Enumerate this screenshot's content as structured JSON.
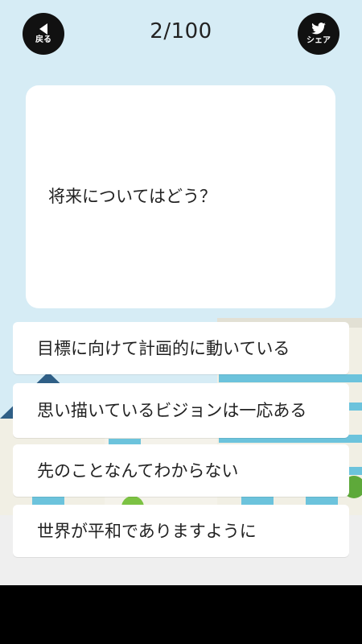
{
  "header": {
    "back_label": "戻る",
    "counter": "2/100",
    "share_label": "シェア"
  },
  "question": {
    "text": "将来についてはどう？"
  },
  "answers": [
    {
      "label": "目標に向けて計画的に動いている"
    },
    {
      "label": "思い描いているビジョンは一応ある"
    },
    {
      "label": "先のことなんてわからない"
    },
    {
      "label": "世界が平和でありますように"
    }
  ],
  "colors": {
    "sky": "#d6ecf5",
    "button_bg": "#111111",
    "card_bg": "#ffffff",
    "text": "#222222"
  }
}
